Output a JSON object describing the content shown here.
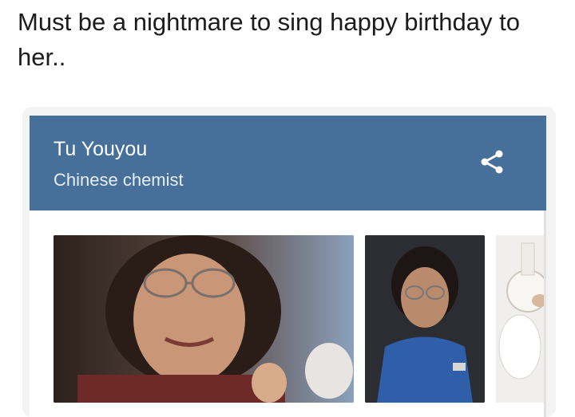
{
  "post": {
    "caption": "Must be a nightmare to sing happy birthday to her.."
  },
  "knowledge_card": {
    "title": "Tu Youyou",
    "subtitle": "Chinese chemist",
    "share_icon": "share-icon",
    "header_color": "#46709a"
  },
  "images": [
    {
      "alt": "Tu Youyou portrait smiling"
    },
    {
      "alt": "Tu Youyou in blue jacket"
    },
    {
      "alt": "Laboratory flask"
    }
  ]
}
